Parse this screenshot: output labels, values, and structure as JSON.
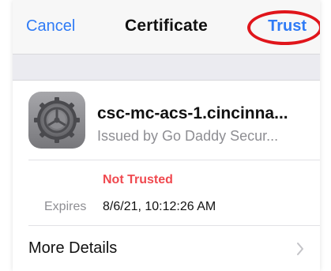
{
  "navbar": {
    "cancel_label": "Cancel",
    "title": "Certificate",
    "trust_label": "Trust"
  },
  "certificate": {
    "icon": "settings-gear-icon",
    "name": "csc-mc-acs-1.cincinna...",
    "issuer": "Issued by Go Daddy Secur...",
    "status": "Not Trusted",
    "expires_label": "Expires",
    "expires_value": "8/6/21, 10:12:26 AM"
  },
  "more_details": {
    "label": "More Details",
    "icon": "chevron-right-icon"
  },
  "colors": {
    "accent": "#2f7bf6",
    "warning": "#f0494f",
    "annotation": "#e0151b"
  }
}
